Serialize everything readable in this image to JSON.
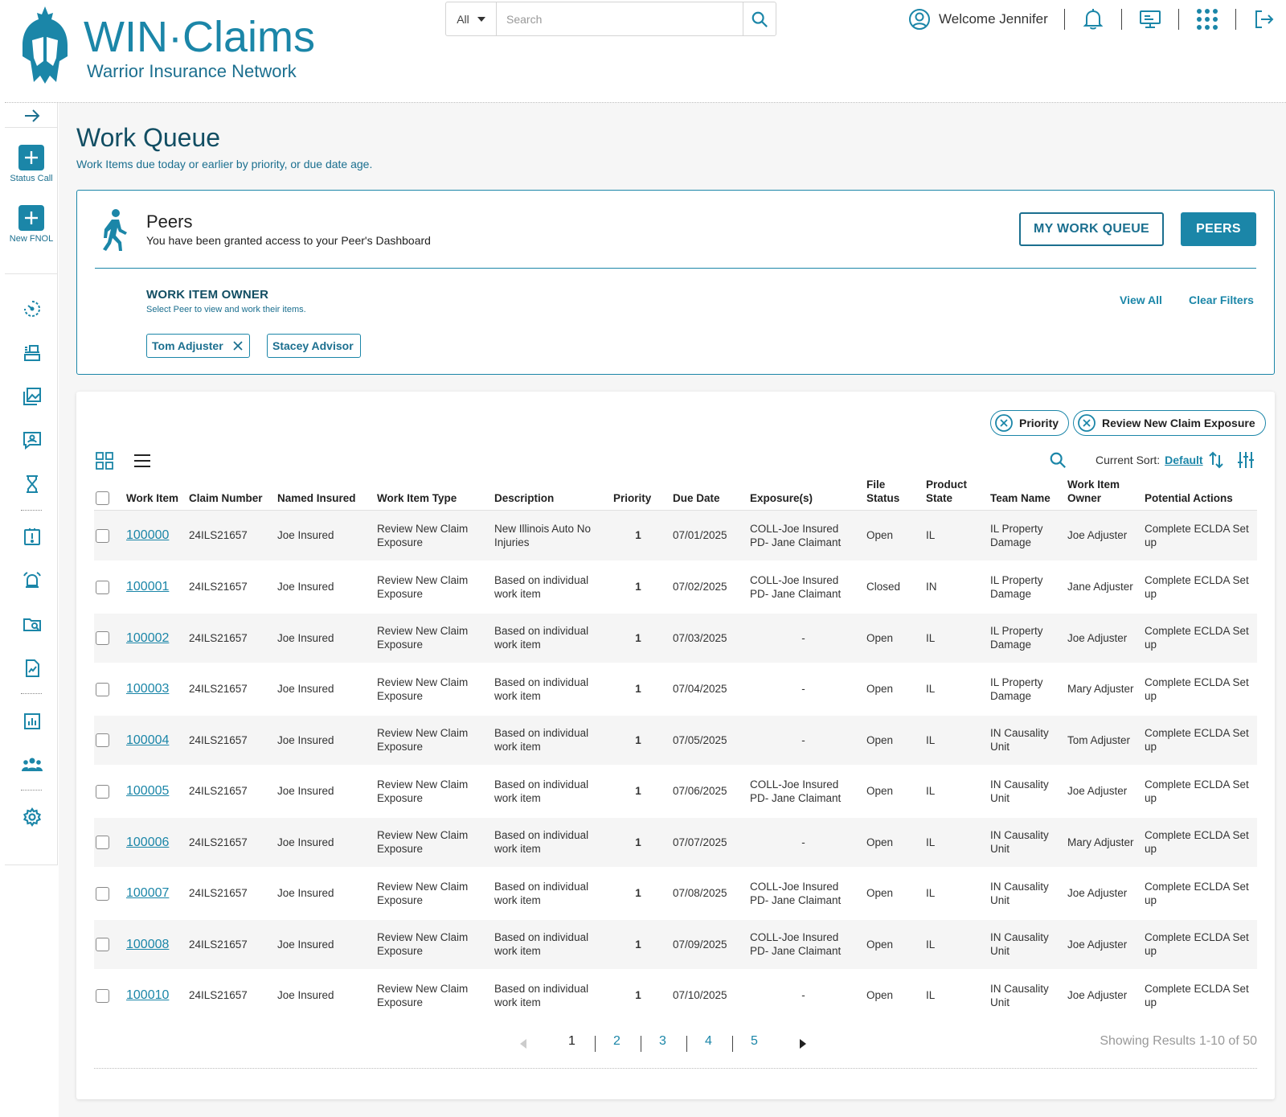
{
  "brand": {
    "title": "WIN·Claims",
    "subtitle": "Warrior Insurance Network",
    "color": "#1b86a8"
  },
  "search": {
    "scope": "All",
    "placeholder": "Search"
  },
  "user": {
    "welcome": "Welcome Jennifer"
  },
  "header_icons": [
    "user-circle-icon",
    "bell-icon",
    "monitor-icon",
    "apps-grid-icon",
    "logout-icon"
  ],
  "sidebar": {
    "status_call": "Status Call",
    "new_fnol": "New FNOL",
    "icons": [
      "expand-arrow-icon",
      "timer-icon",
      "desk-icon",
      "gallery-icon",
      "contact-card-icon",
      "hourglass-icon",
      "alert-box-icon",
      "alarm-icon",
      "folder-search-icon",
      "document-chart-icon",
      "bar-chart-icon",
      "team-icon",
      "settings-icon"
    ]
  },
  "page": {
    "title": "Work Queue",
    "subtitle": "Work Items due today or earlier by priority, or due date age."
  },
  "peers": {
    "title": "Peers",
    "description": "You have been granted access to your Peer's Dashboard",
    "my_work_queue": "MY WORK QUEUE",
    "peers_button": "PEERS",
    "owner_title": "WORK ITEM OWNER",
    "owner_sub": "Select Peer to view and work their items.",
    "view_all": "View All",
    "clear_filters": "Clear Filters",
    "chips": [
      {
        "label": "Tom Adjuster",
        "selected": true
      },
      {
        "label": "Stacey Advisor",
        "selected": false
      }
    ]
  },
  "filters": {
    "chips": [
      "Priority",
      "Review New Claim Exposure"
    ],
    "current_sort_label": "Current Sort:",
    "current_sort_value": "Default"
  },
  "table": {
    "columns": [
      "Work Item",
      "Claim Number",
      "Named Insured",
      "Work Item Type",
      "Description",
      "Priority",
      "Due Date",
      "Exposure(s)",
      "File Status",
      "Product State",
      "Team Name",
      "Work Item Owner",
      "Potential Actions"
    ],
    "rows": [
      {
        "work_item": "100000",
        "claim": "24ILS21657",
        "insured": "Joe Insured",
        "type": "Review New Claim Exposure",
        "description": "New Illinois Auto No Injuries",
        "priority": "1",
        "due": "07/01/2025",
        "exposure": "COLL-Joe Insured PD- Jane Claimant",
        "status": "Open",
        "state": "IL",
        "team": "IL Property Damage",
        "owner": "Joe Adjuster",
        "action": "Complete ECLDA Set up"
      },
      {
        "work_item": "100001",
        "claim": "24ILS21657",
        "insured": "Joe Insured",
        "type": "Review New Claim Exposure",
        "description": "Based on individual work item",
        "priority": "1",
        "due": "07/02/2025",
        "exposure": "COLL-Joe Insured PD- Jane Claimant",
        "status": "Closed",
        "state": "IN",
        "team": "IL Property Damage",
        "owner": "Jane Adjuster",
        "action": "Complete ECLDA Set up"
      },
      {
        "work_item": "100002",
        "claim": "24ILS21657",
        "insured": "Joe Insured",
        "type": "Review New Claim Exposure",
        "description": "Based on individual work item",
        "priority": "1",
        "due": "07/03/2025",
        "exposure": "-",
        "status": "Open",
        "state": "IL",
        "team": "IL Property Damage",
        "owner": "Joe Adjuster",
        "action": "Complete ECLDA Set up"
      },
      {
        "work_item": "100003",
        "claim": "24ILS21657",
        "insured": "Joe Insured",
        "type": "Review New Claim Exposure",
        "description": "Based on individual work item",
        "priority": "1",
        "due": "07/04/2025",
        "exposure": "-",
        "status": "Open",
        "state": "IL",
        "team": "IL Property Damage",
        "owner": "Mary Adjuster",
        "action": "Complete ECLDA Set up"
      },
      {
        "work_item": "100004",
        "claim": "24ILS21657",
        "insured": "Joe Insured",
        "type": "Review New Claim Exposure",
        "description": "Based on individual work item",
        "priority": "1",
        "due": "07/05/2025",
        "exposure": "-",
        "status": "Open",
        "state": "IL",
        "team": "IN Causality Unit",
        "owner": "Tom Adjuster",
        "action": "Complete ECLDA Set up"
      },
      {
        "work_item": "100005",
        "claim": "24ILS21657",
        "insured": "Joe Insured",
        "type": "Review New Claim Exposure",
        "description": "Based on individual work item",
        "priority": "1",
        "due": "07/06/2025",
        "exposure": "COLL-Joe Insured PD- Jane Claimant",
        "status": "Open",
        "state": "IL",
        "team": "IN Causality Unit",
        "owner": "Joe Adjuster",
        "action": "Complete ECLDA Set up"
      },
      {
        "work_item": "100006",
        "claim": "24ILS21657",
        "insured": "Joe Insured",
        "type": "Review New Claim Exposure",
        "description": "Based on individual work item",
        "priority": "1",
        "due": "07/07/2025",
        "exposure": "-",
        "status": "Open",
        "state": "IL",
        "team": "IN Causality Unit",
        "owner": "Mary Adjuster",
        "action": "Complete ECLDA Set up"
      },
      {
        "work_item": "100007",
        "claim": "24ILS21657",
        "insured": "Joe Insured",
        "type": "Review New Claim Exposure",
        "description": "Based on individual work item",
        "priority": "1",
        "due": "07/08/2025",
        "exposure": "COLL-Joe Insured PD- Jane Claimant",
        "status": "Open",
        "state": "IL",
        "team": "IN Causality Unit",
        "owner": "Joe Adjuster",
        "action": "Complete ECLDA Set up"
      },
      {
        "work_item": "100008",
        "claim": "24ILS21657",
        "insured": "Joe Insured",
        "type": "Review New Claim Exposure",
        "description": "Based on individual work item",
        "priority": "1",
        "due": "07/09/2025",
        "exposure": "COLL-Joe Insured PD- Jane Claimant",
        "status": "Open",
        "state": "IL",
        "team": "IN Causality Unit",
        "owner": "Joe Adjuster",
        "action": "Complete ECLDA Set up"
      },
      {
        "work_item": "100010",
        "claim": "24ILS21657",
        "insured": "Joe Insured",
        "type": "Review New Claim Exposure",
        "description": "Based on individual work item",
        "priority": "1",
        "due": "07/10/2025",
        "exposure": "-",
        "status": "Open",
        "state": "IL",
        "team": "IN Causality Unit",
        "owner": "Joe Adjuster",
        "action": "Complete ECLDA Set up"
      }
    ]
  },
  "pagination": {
    "pages": [
      "1",
      "2",
      "3",
      "4",
      "5"
    ],
    "current": "1",
    "results": "Showing Results 1-10 of 50"
  }
}
